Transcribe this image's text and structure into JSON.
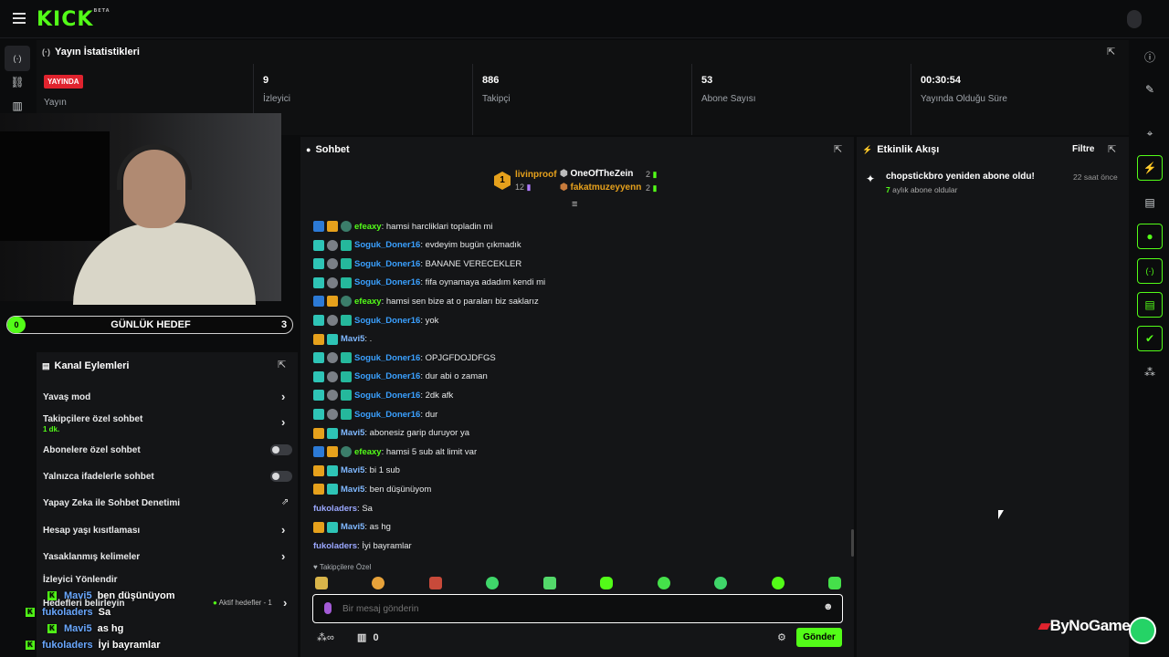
{
  "brand": {
    "logo": "KICK",
    "beta": "BETA"
  },
  "stats": {
    "title": "Yayın İstatistikleri",
    "live_badge": "YAYINDA",
    "live_label": "Yayın",
    "viewers_value": "9",
    "viewers_label": "İzleyici",
    "followers_value": "886",
    "followers_label": "Takipçi",
    "subs_value": "53",
    "subs_label": "Abone Sayısı",
    "duration_value": "00:30:54",
    "duration_label": "Yayında Olduğu Süre"
  },
  "goal": {
    "left": "0",
    "title": "GÜNLÜK HEDEF",
    "right": "3"
  },
  "channel_actions": {
    "title": "Kanal Eylemleri",
    "items": [
      {
        "label": "Yavaş mod",
        "sub": ""
      },
      {
        "label": "Takipçilere özel sohbet",
        "sub": "1 dk."
      },
      {
        "label": "Abonelere özel sohbet",
        "sub": ""
      },
      {
        "label": "Yalnızca ifadelerle sohbet",
        "sub": ""
      },
      {
        "label": "Yapay Zeka ile Sohbet Denetimi",
        "sub": ""
      },
      {
        "label": "Hesap yaşı kısıtlaması",
        "sub": ""
      },
      {
        "label": "Yasaklanmış kelimeler",
        "sub": ""
      },
      {
        "label": "İzleyici Yönlendir",
        "sub": ""
      },
      {
        "label": "Hedefleri belirleyin",
        "sub": "Aktif hedefler - 1"
      }
    ]
  },
  "overlay_chat": [
    {
      "user": "Mavi5",
      "text": "ben düşünüyom"
    },
    {
      "user": "fukoladers",
      "text": "Sa"
    },
    {
      "user": "Mavi5",
      "text": "as hg"
    },
    {
      "user": "fukoladers",
      "text": "İyi bayramlar"
    }
  ],
  "chat": {
    "title": "Sohbet",
    "leaderboard": {
      "first_rank": "1",
      "first_user": "livinproof",
      "first_count": "12",
      "second_user": "OneOfTheZein",
      "second_count": "2",
      "third_user": "fakatmuzeyyenn",
      "third_count": "2"
    },
    "messages": [
      {
        "user": "efeaxy",
        "text": ": hamsi harcliklari topladin mi",
        "color": "green",
        "badges": [
          "blue",
          "gold",
          "shield"
        ]
      },
      {
        "user": "Soguk_Doner16",
        "text": ": evdeyim bugün çıkmadık",
        "color": "blue",
        "badges": [
          "teal",
          "gray",
          "gift"
        ]
      },
      {
        "user": "Soguk_Doner16",
        "text": ": BANANE VERECEKLER",
        "color": "blue",
        "badges": [
          "teal",
          "gray",
          "gift"
        ]
      },
      {
        "user": "Soguk_Doner16",
        "text": ": fifa oynamaya adadım kendi mi",
        "color": "blue",
        "badges": [
          "teal",
          "gray",
          "gift"
        ]
      },
      {
        "user": "efeaxy",
        "text": ": hamsi sen bize at o paraları biz saklarız",
        "color": "green",
        "badges": [
          "blue",
          "gold",
          "shield"
        ]
      },
      {
        "user": "Soguk_Doner16",
        "text": ": yok",
        "color": "blue",
        "badges": [
          "teal",
          "gray",
          "gift"
        ]
      },
      {
        "user": "Mavi5",
        "text": ": .",
        "color": "lblue",
        "badges": [
          "gold",
          "teal"
        ]
      },
      {
        "user": "Soguk_Doner16",
        "text": ": OPJGFDOJDFGS",
        "color": "blue",
        "badges": [
          "teal",
          "gray",
          "gift"
        ]
      },
      {
        "user": "Soguk_Doner16",
        "text": ": dur abi o zaman",
        "color": "blue",
        "badges": [
          "teal",
          "gray",
          "gift"
        ]
      },
      {
        "user": "Soguk_Doner16",
        "text": ": 2dk afk",
        "color": "blue",
        "badges": [
          "teal",
          "gray",
          "gift"
        ]
      },
      {
        "user": "Soguk_Doner16",
        "text": ": dur",
        "color": "blue",
        "badges": [
          "teal",
          "gray",
          "gift"
        ]
      },
      {
        "user": "Mavi5",
        "text": ": abonesiz garip duruyor ya",
        "color": "lblue",
        "badges": [
          "gold",
          "teal"
        ]
      },
      {
        "user": "efeaxy",
        "text": ": hamsi 5 sub alt limit var",
        "color": "green",
        "badges": [
          "blue",
          "gold",
          "shield"
        ]
      },
      {
        "user": "Mavi5",
        "text": ": bi 1 sub",
        "color": "lblue",
        "badges": [
          "gold",
          "teal"
        ]
      },
      {
        "user": "Mavi5",
        "text": ": ben düşünüyom",
        "color": "lblue",
        "badges": [
          "gold",
          "teal"
        ]
      },
      {
        "user": "fukoladers",
        "text": ": Sa",
        "color": "purple",
        "badges": []
      },
      {
        "user": "Mavi5",
        "text": ": as hg",
        "color": "lblue",
        "badges": [
          "gold",
          "teal"
        ]
      },
      {
        "user": "fukoladers",
        "text": ": İyi bayramlar",
        "color": "purple",
        "badges": []
      }
    ],
    "followers_only_label": "Takipçilere Özel",
    "input_placeholder": "Bir mesaj gönderin",
    "points": "∞",
    "gift_count": "0",
    "send_label": "Gönder"
  },
  "activity": {
    "title": "Etkinlik Akışı",
    "filter_label": "Filtre",
    "event_title": "chopstickbro yeniden abone oldu!",
    "event_time": "22 saat önce",
    "event_months": "7",
    "event_sub": "aylık abone oldular"
  },
  "watermark": "ByNoGame"
}
